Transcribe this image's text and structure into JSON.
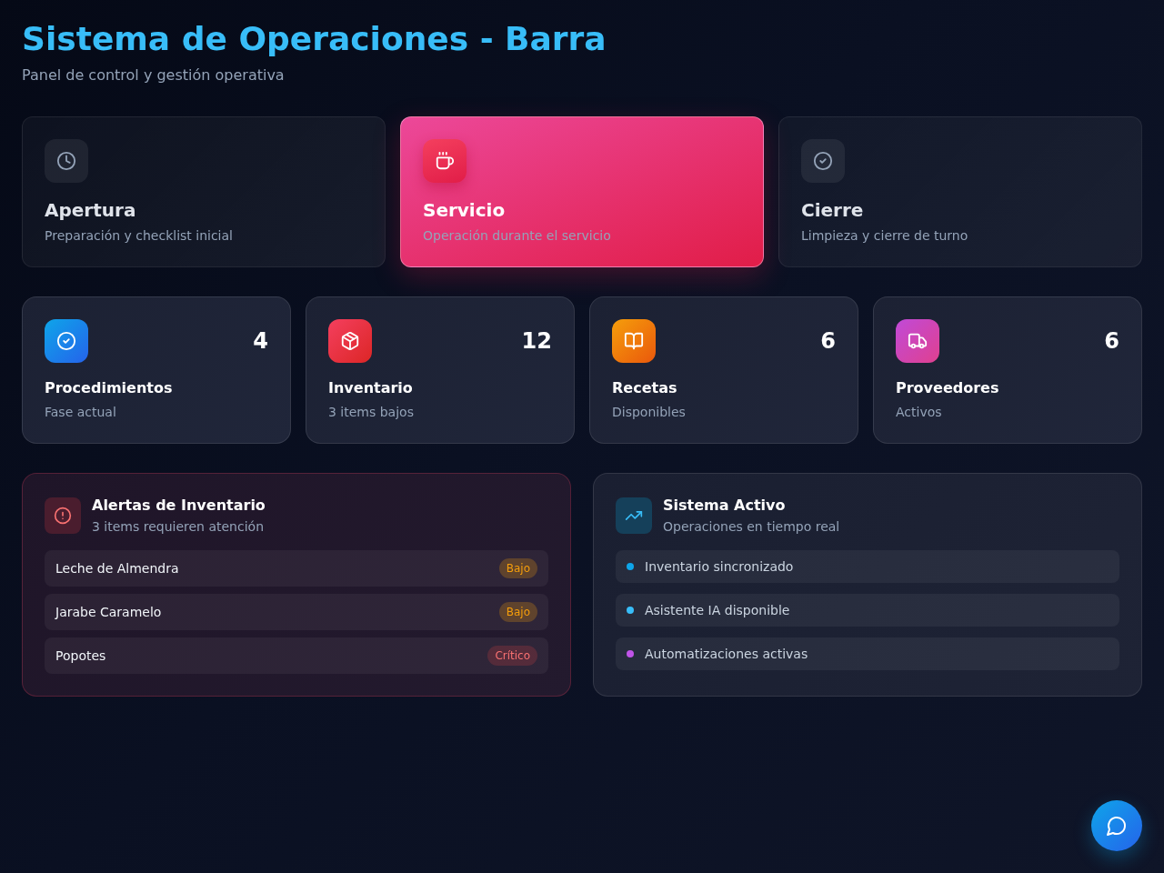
{
  "header": {
    "title": "Sistema de Operaciones - Barra",
    "subtitle": "Panel de control y gestión operativa"
  },
  "phases": [
    {
      "kind": "opening",
      "title": "Apertura",
      "description": "Preparación y checklist inicial",
      "selected": false
    },
    {
      "kind": "service",
      "title": "Servicio",
      "description": "Operación durante el servicio",
      "selected": true
    },
    {
      "kind": "closing",
      "title": "Cierre",
      "description": "Limpieza y cierre de turno",
      "selected": false
    }
  ],
  "stats": [
    {
      "kind": "procedures",
      "value": "4",
      "title": "Procedimientos",
      "caption": "Fase actual"
    },
    {
      "kind": "inventory",
      "value": "12",
      "title": "Inventario",
      "caption": "3 items bajos"
    },
    {
      "kind": "recipes",
      "value": "6",
      "title": "Recetas",
      "caption": "Disponibles"
    },
    {
      "kind": "suppliers",
      "value": "6",
      "title": "Proveedores",
      "caption": "Activos"
    }
  ],
  "alerts_panel": {
    "title": "Alertas de Inventario",
    "subtitle": "3 items requieren atención",
    "items": [
      {
        "name": "Leche de Almendra",
        "status": "Bajo",
        "critical": false
      },
      {
        "name": "Jarabe Caramelo",
        "status": "Bajo",
        "critical": false
      },
      {
        "name": "Popotes",
        "status": "Crítico",
        "critical": true
      }
    ]
  },
  "system_panel": {
    "title": "Sistema Activo",
    "subtitle": "Operaciones en tiempo real",
    "items": [
      {
        "label": "Inventario sincronizado",
        "color": "#0ea5e9"
      },
      {
        "label": "Asistente IA disponible",
        "color": "#38bdf8"
      },
      {
        "label": "Automatizaciones activas",
        "color": "#c054e8"
      }
    ]
  }
}
